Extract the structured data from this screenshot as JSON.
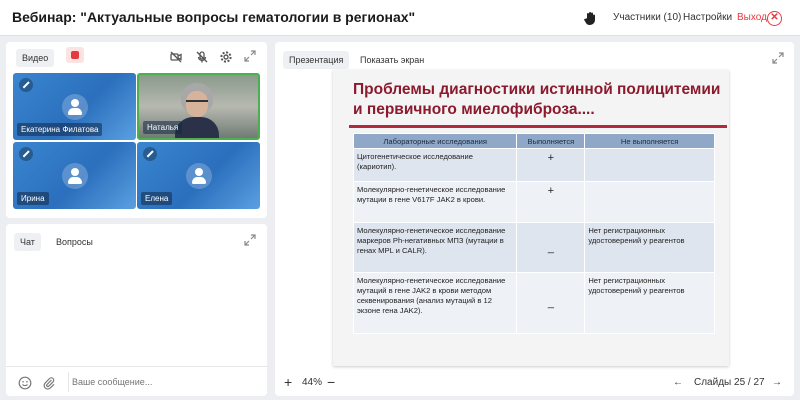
{
  "header": {
    "title": "Вебинар: \"Актуальные вопросы гематологии в регионах\"",
    "participants_label": "Участники (10)",
    "settings_label": "Настройки",
    "exit_label": "Выход",
    "exit_icon": "close-circle-icon",
    "hand_icon": "raise-hand-icon"
  },
  "video_panel": {
    "tab_label": "Видео",
    "participants": [
      {
        "name": "Екатерина Филатова",
        "camera": false
      },
      {
        "name": "Наталья",
        "camera": true
      },
      {
        "name": "Ирина",
        "camera": false
      },
      {
        "name": "Елена",
        "camera": false
      }
    ]
  },
  "chat_panel": {
    "tabs": [
      "Чат",
      "Вопросы"
    ],
    "input_placeholder": "Ваше сообщение..."
  },
  "presentation": {
    "tabs": [
      "Презентация",
      "Показать экран"
    ],
    "zoom": "44%",
    "pager": "Слайды 25 / 27",
    "slide": {
      "title": "Проблемы диагностики истинной полицитемии и первичного миелофиброза....",
      "table": {
        "headers": [
          "Лабораторные исследования",
          "Выполняется",
          "Не выполняется"
        ],
        "rows": [
          [
            "Цитогенетическое исследование (кариотип).",
            "+",
            ""
          ],
          [
            "Молекулярно-генетическое исследование мутации в гене V617F JAK2 в крови.",
            "+",
            ""
          ],
          [
            "Молекулярно-генетическое исследование маркеров Ph-негативных МПЗ (мутации в генах MPL и CALR).",
            "_",
            "Нет регистрационных удостоверений у реагентов"
          ],
          [
            "Молекулярно-генетическое исследование мутаций в гене JAK2 в крови методом секвенирования (анализ мутаций в 12 экзоне гена JAK2).",
            "_",
            "Нет регистрационных удостоверений у реагентов"
          ]
        ]
      }
    }
  },
  "colors": {
    "accent_red": "#e5393f",
    "slide_title": "#8b1a2e",
    "tile_blue": "#2b6fbd",
    "table_header": "#8fa8c8"
  }
}
